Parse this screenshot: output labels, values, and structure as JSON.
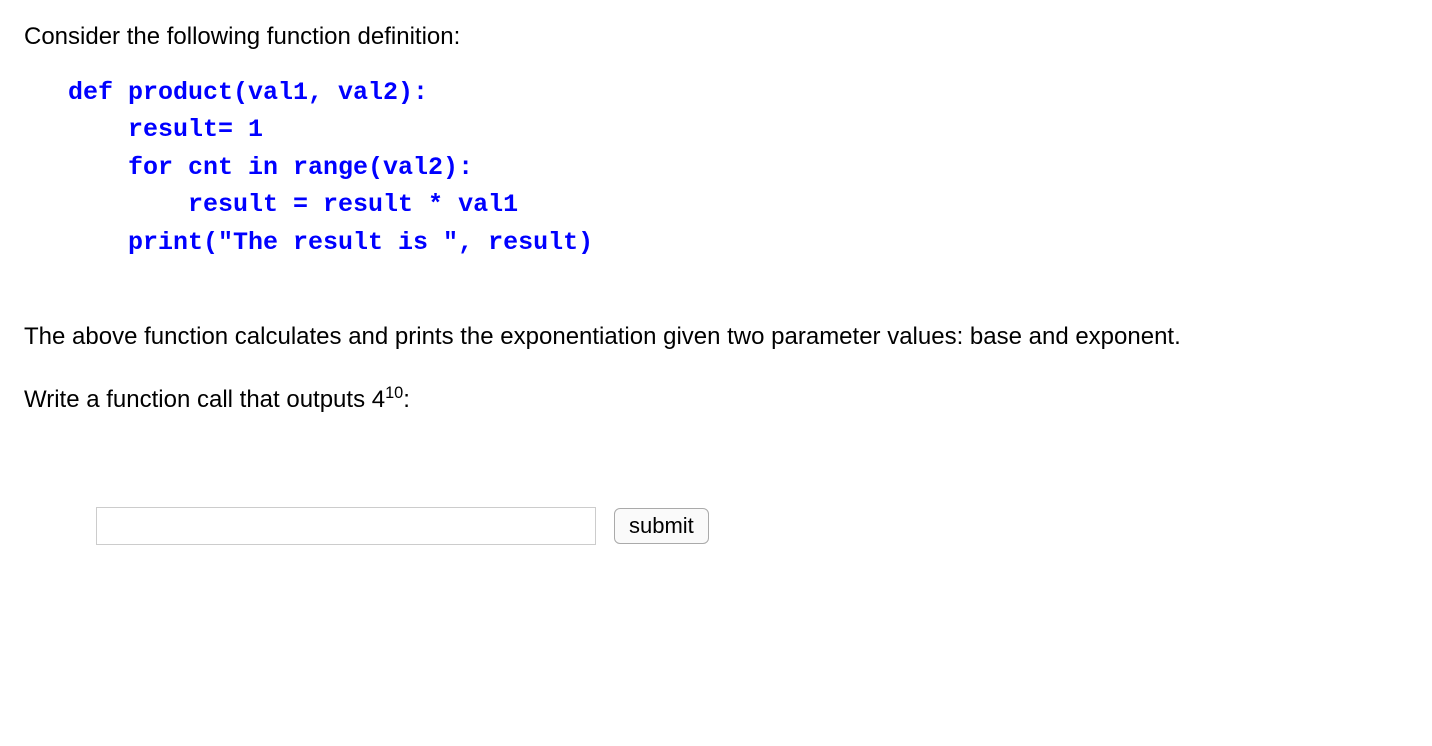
{
  "intro": "Consider the following function definition:",
  "code": "def product(val1, val2):\n    result= 1\n    for cnt in range(val2):\n        result = result * val1\n    print(\"The result is \", result)",
  "description": "The above function calculates and prints the exponentiation given two parameter values: base and exponent.",
  "prompt_prefix": "Write a function call that outputs ",
  "prompt_base": "4",
  "prompt_exp": "10",
  "prompt_suffix": ":",
  "answer_value": "",
  "submit_label": "submit"
}
